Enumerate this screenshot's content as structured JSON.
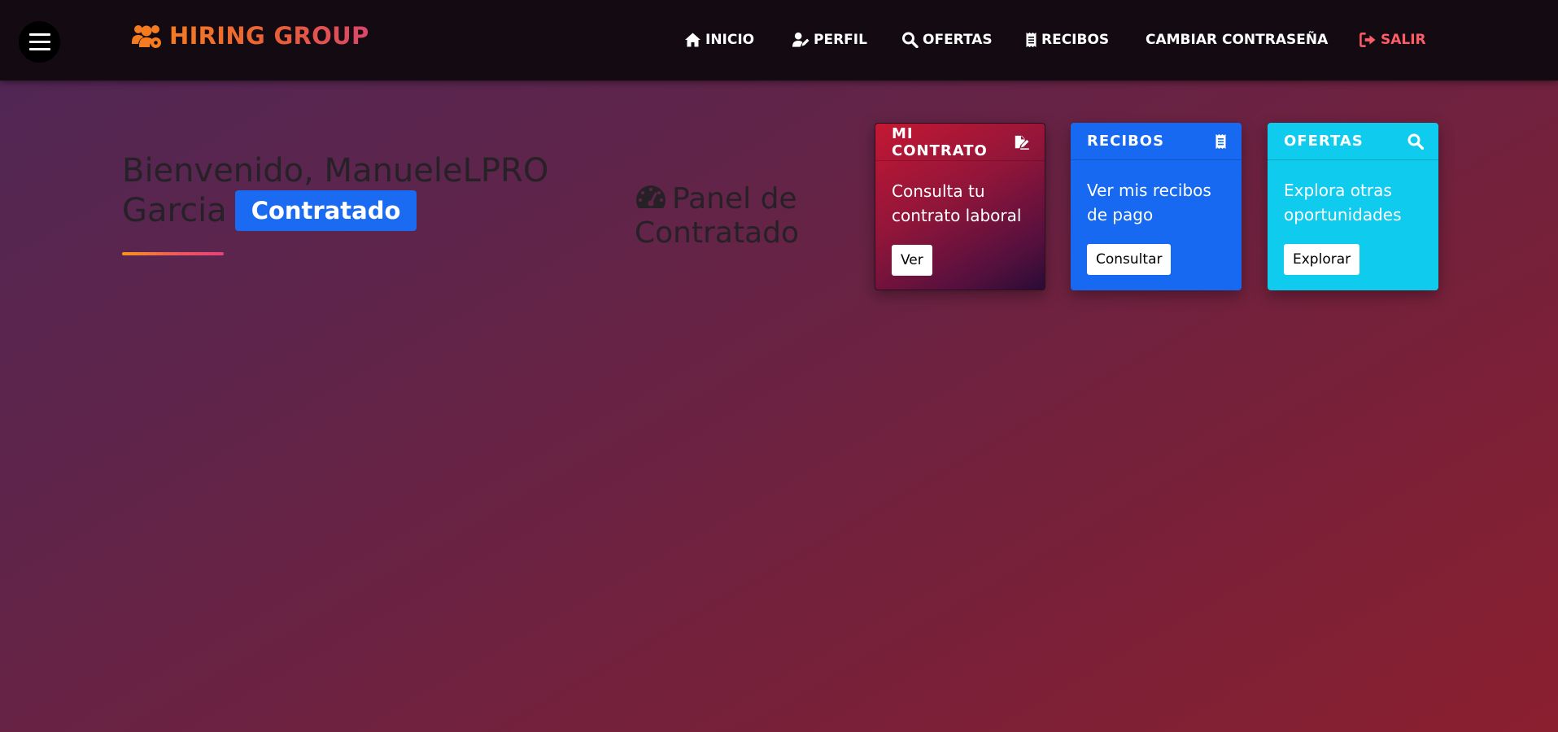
{
  "navbar": {
    "brand": "HIRING GROUP",
    "links": [
      {
        "label": "INICIO",
        "icon": "home-icon"
      },
      {
        "label": "PERFIL",
        "icon": "user-edit-icon"
      },
      {
        "label": "OFERTAS",
        "icon": "search-icon"
      },
      {
        "label": "RECIBOS",
        "icon": "receipt-icon"
      },
      {
        "label": "CAMBIAR CONTRASEÑA",
        "icon": ""
      },
      {
        "label": "SALIR",
        "icon": "sign-out-icon"
      }
    ]
  },
  "welcome": {
    "line1": "Bienvenido, ManueleLPRO",
    "line2": "Garcia",
    "badge": "Contratado"
  },
  "panel": {
    "title": "Panel de Contratado"
  },
  "cards": [
    {
      "title": "MI CONTRATO",
      "icon": "file-signature-icon",
      "text": "Consulta tu contrato laboral",
      "button": "Ver"
    },
    {
      "title": "RECIBOS",
      "icon": "receipt-icon",
      "text": "Ver mis recibos de pago",
      "button": "Consultar"
    },
    {
      "title": "OFERTAS",
      "icon": "search-icon",
      "text": "Explora otras oportunidades",
      "button": "Explorar"
    }
  ],
  "colors": {
    "navbar_bg": "#130a12",
    "brand_gradient_start": "#f47b20",
    "brand_gradient_end": "#d9466a",
    "logout": "#ff5d66",
    "badge": "#1a6bf2",
    "card_contract": "#c41833",
    "card_receipts": "#1669f0",
    "card_offers": "#0fcbee"
  }
}
